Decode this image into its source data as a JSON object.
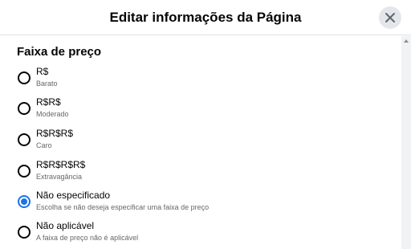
{
  "dialog": {
    "title": "Editar informações da Página"
  },
  "section": {
    "title": "Faixa de preço"
  },
  "options": [
    {
      "label": "R$",
      "description": "Barato",
      "checked": false
    },
    {
      "label": "R$R$",
      "description": "Moderado",
      "checked": false
    },
    {
      "label": "R$R$R$",
      "description": "Caro",
      "checked": false
    },
    {
      "label": "R$R$R$R$",
      "description": "Extravagância",
      "checked": false
    },
    {
      "label": "Não especificado",
      "description": "Escolha se não deseja especificar uma faixa de preço",
      "checked": true
    },
    {
      "label": "Não aplicável",
      "description": "A faixa de preço não é aplicável",
      "checked": false
    }
  ],
  "icons": {
    "close": "close-icon"
  },
  "colors": {
    "accent": "#1b74e4",
    "secondary_text": "#65676b",
    "close_bg": "#e4e6eb"
  }
}
